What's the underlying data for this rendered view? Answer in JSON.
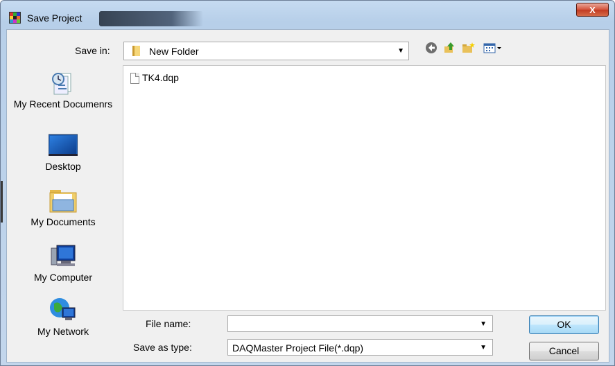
{
  "window": {
    "title": "Save Project",
    "close_label": "X"
  },
  "toolbar": {
    "save_in_label": "Save in:",
    "save_in_value": "New Folder",
    "icons": [
      "back-icon",
      "up-folder-icon",
      "new-folder-icon",
      "view-menu-icon"
    ]
  },
  "places": [
    {
      "label": "My Recent Documenrs",
      "icon": "recent-documents-icon"
    },
    {
      "label": "Desktop",
      "icon": "desktop-icon"
    },
    {
      "label": "My Documents",
      "icon": "my-documents-icon"
    },
    {
      "label": "My Computer",
      "icon": "my-computer-icon"
    },
    {
      "label": "My Network",
      "icon": "my-network-icon"
    }
  ],
  "files": [
    {
      "name": "TK4.dqp"
    }
  ],
  "form": {
    "file_name_label": "File name:",
    "file_name_value": "",
    "save_as_type_label": "Save as type:",
    "save_as_type_value": "DAQMaster Project File(*.dqp)"
  },
  "buttons": {
    "ok": "OK",
    "cancel": "Cancel"
  }
}
